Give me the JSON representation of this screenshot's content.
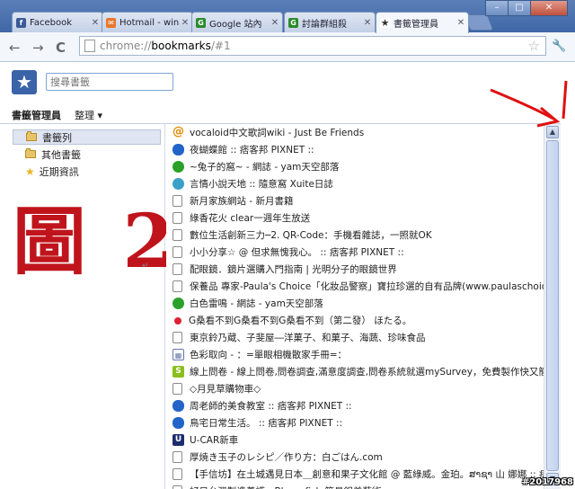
{
  "window": {
    "tabs": [
      {
        "label": "Facebook",
        "icon": "facebook-icon",
        "color": "#3b5998",
        "glyph": "f"
      },
      {
        "label": "Hotmail - win",
        "icon": "hotmail-icon",
        "color": "#e8762c",
        "glyph": "✉"
      },
      {
        "label": "Google 站內",
        "icon": "google-site-icon",
        "color": "#2a8a2a",
        "glyph": "G"
      },
      {
        "label": "討論群組殺",
        "icon": "google-groups-icon",
        "color": "#2a8a2a",
        "glyph": "G"
      },
      {
        "label": "書籤管理員",
        "icon": "star-icon",
        "color": "#ffffff",
        "glyph": "★"
      }
    ],
    "controls": {
      "minimize": "–",
      "maximize": "□",
      "close": "✕"
    }
  },
  "toolbar": {
    "back": "←",
    "forward": "→",
    "reload": "C",
    "url_scheme": "chrome://",
    "url_host": "bookmarks",
    "url_path": "/#1"
  },
  "header": {
    "search_placeholder": "搜尋書籤",
    "title": "書籤管理員",
    "organize_menu": "整理 ▾"
  },
  "sidebar": {
    "items": [
      {
        "label": "書籤列",
        "icon": "folder-icon"
      },
      {
        "label": "其他書籤",
        "icon": "folder-icon"
      },
      {
        "label": "近期資訊",
        "icon": "recent-star-icon"
      }
    ]
  },
  "annotation": {
    "text": "圖 2",
    "paragraph_mark": "↵"
  },
  "bookmarks": [
    {
      "title": "vocaloid中文歌詞wiki - Just Be Friends",
      "icon": "at"
    },
    {
      "title": "夜蝴蝶館 :: 痞客邦 PIXNET ::",
      "icon": "pix"
    },
    {
      "title": "~兔子的窩~ - 網誌 - yam天空部落",
      "icon": "yam"
    },
    {
      "title": "言情小說天地 :: 隨意窩 Xuite日誌",
      "icon": "globe"
    },
    {
      "title": "新月家族網站 - 新月書籍",
      "icon": "doc"
    },
    {
      "title": "綠香花火 clear一週年生放送",
      "icon": "doc"
    },
    {
      "title": "數位生活創新三力─2. QR-Code：手機看雜誌，一照就OK",
      "icon": "doc"
    },
    {
      "title": "小小分享☆ @ 但求無愧我心。 :: 痞客邦 PIXNET ::",
      "icon": "doc"
    },
    {
      "title": "配眼鏡．鏡片選購入門指南 | 光明分子的眼鏡世界",
      "icon": "doc"
    },
    {
      "title": "保養品 專家-Paula's Choice「化妝品警察」寶拉珍選的自有品牌(www.paulaschoic",
      "icon": "doc"
    },
    {
      "title": "白色雷鳴 - 網誌 - yam天空部落",
      "icon": "yam"
    },
    {
      "title": "G桑看不到G桑看不到G桑看不到（第二發） ほたる。",
      "icon": "dot"
    },
    {
      "title": "東京鈴乃蔵、子斐屋―洋菓子、和菓子、海蔬、珍味食品",
      "icon": "doc"
    },
    {
      "title": "色彩取向 - ：=單眼相機散家手冊=：",
      "icon": "grid"
    },
    {
      "title": "線上問卷 - 線上問卷,問卷調查,滿意度調查,問卷系統就選mySurvey，免費製作快又簡",
      "icon": "s"
    },
    {
      "title": "◇月見草購物車◇",
      "icon": "doc"
    },
    {
      "title": "周老師的美食教室 :: 痞客邦 PIXNET ::",
      "icon": "pix"
    },
    {
      "title": "鳥宅日常生活。 :: 痞客邦 PIXNET ::",
      "icon": "pix"
    },
    {
      "title": "U-CAR新車",
      "icon": "u"
    },
    {
      "title": "厚焼き玉子のレシピ／作り方：白ごはん.com",
      "icon": "doc"
    },
    {
      "title": "【手信坊】在土城遇見日本＿創意和果子文化館 @ 藍綠威。金珀。ສາຊາ 山 娜娜 :: 痞",
      "icon": "doc"
    },
    {
      "title": "好日台灣製造養護 - Bluerafish 簡易鋁美藝術",
      "icon": "doc"
    }
  ],
  "watermark": "#2017968",
  "colors": {
    "arrow": "#e01010",
    "annotation": "#c0141c",
    "accent": "#3a63a8"
  }
}
